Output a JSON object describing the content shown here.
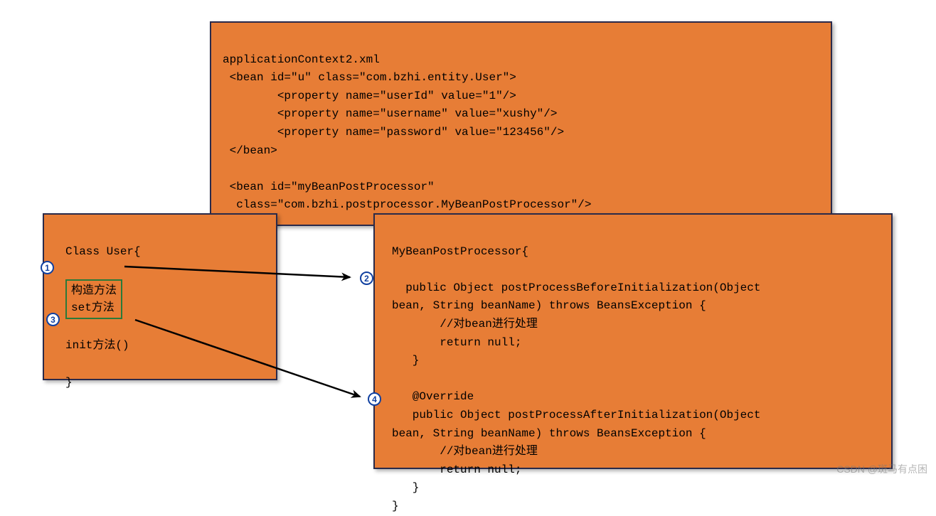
{
  "xml": {
    "title": "applicationContext2.xml",
    "line1": " <bean id=\"u\" class=\"com.bzhi.entity.User\">",
    "line2": "        <property name=\"userId\" value=\"1\"/>",
    "line3": "        <property name=\"username\" value=\"xushy\"/>",
    "line4": "        <property name=\"password\" value=\"123456\"/>",
    "line5": " </bean>",
    "line6": " <bean id=\"myBeanPostProcessor\"",
    "line7": "  class=\"com.bzhi.postprocessor.MyBeanPostProcessor\"/>"
  },
  "user": {
    "header": "Class User{",
    "l1": "构造方法",
    "l2": "set方法",
    "l3": "init方法()",
    "close": "}"
  },
  "proc": {
    "header": "MyBeanPostProcessor{",
    "l1": "  public Object postProcessBeforeInitialization(Object",
    "l2": "bean, String beanName) throws BeansException {",
    "l3": "       //对bean进行处理",
    "l4": "       return null;",
    "l5": "   }",
    "l6": "   @Override",
    "l7": "   public Object postProcessAfterInitialization(Object",
    "l8": "bean, String beanName) throws BeansException {",
    "l9": "       //对bean进行处理",
    "l10": "       return null;",
    "l11": "   }",
    "close": "}"
  },
  "badges": {
    "n1": "1",
    "n2": "2",
    "n3": "3",
    "n4": "4"
  },
  "watermark": "CSDN @斑马有点困"
}
